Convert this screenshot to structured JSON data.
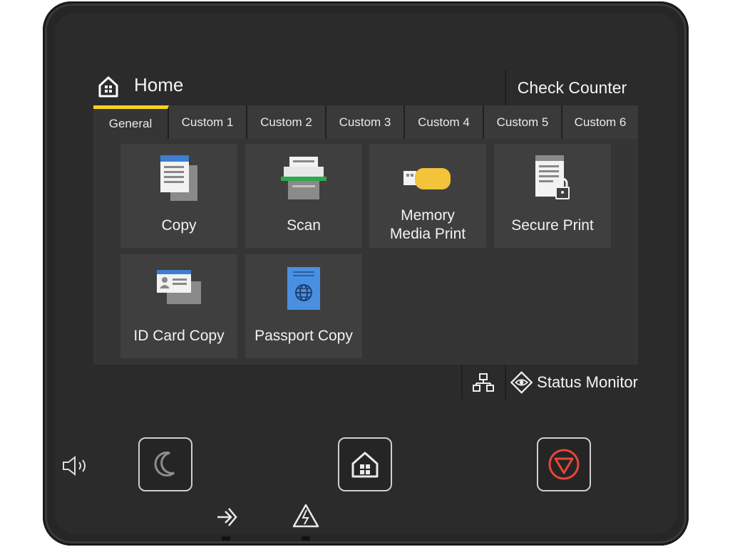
{
  "header": {
    "title": "Home",
    "check_counter": "Check Counter"
  },
  "tabs": [
    {
      "label": "General",
      "active": true
    },
    {
      "label": "Custom 1"
    },
    {
      "label": "Custom 2"
    },
    {
      "label": "Custom 3"
    },
    {
      "label": "Custom 4"
    },
    {
      "label": "Custom 5"
    },
    {
      "label": "Custom 6"
    }
  ],
  "tiles": [
    {
      "label": "Copy",
      "icon": "copy-icon"
    },
    {
      "label": "Scan",
      "icon": "scan-icon"
    },
    {
      "label": "Memory\nMedia Print",
      "icon": "usb-memory-icon"
    },
    {
      "label": "Secure Print",
      "icon": "secure-print-icon"
    },
    {
      "label": "ID Card Copy",
      "icon": "id-card-icon"
    },
    {
      "label": "Passport Copy",
      "icon": "passport-icon"
    }
  ],
  "footer": {
    "status_monitor": "Status Monitor"
  },
  "colors": {
    "accent_yellow": "#f4d21f",
    "stop_red": "#e8463a",
    "tile_bg": "#3f3f3f"
  }
}
